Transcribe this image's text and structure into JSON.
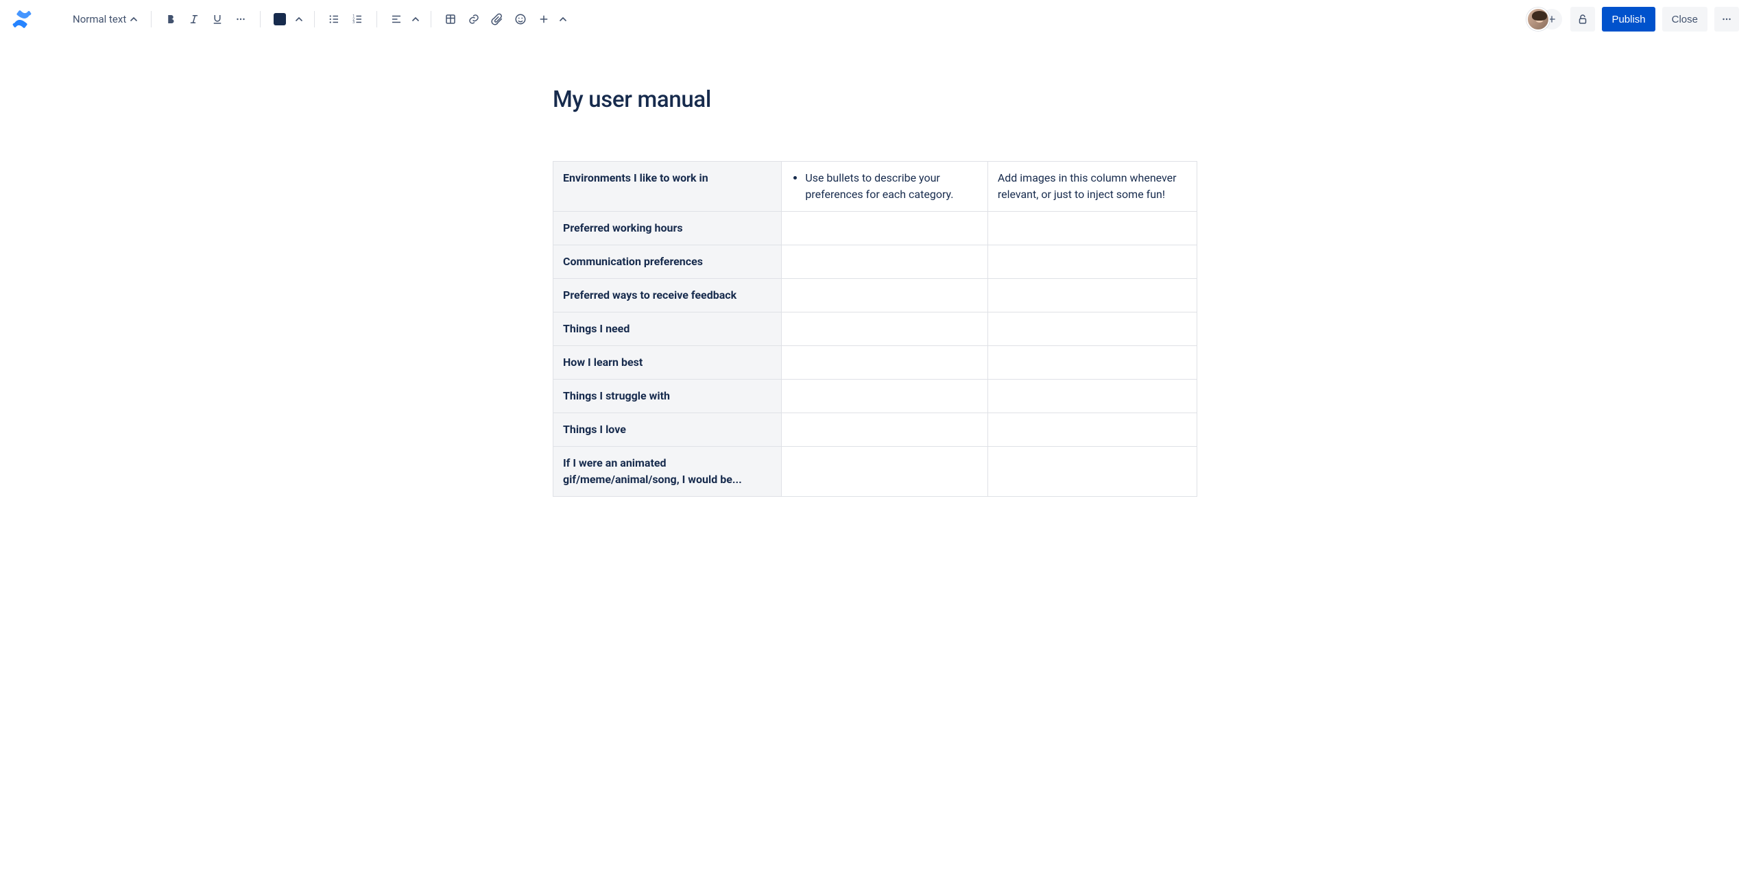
{
  "toolbar": {
    "text_style": "Normal text",
    "publish_label": "Publish",
    "close_label": "Close"
  },
  "page": {
    "title": "My user manual"
  },
  "table": {
    "rows": [
      {
        "label": "Environments I like to work in",
        "bullet": "Use bullets to describe your preferences for each category.",
        "note": "Add images in this column whenever relevant, or just to inject some fun!"
      },
      {
        "label": "Preferred working hours",
        "bullet": "",
        "note": ""
      },
      {
        "label": "Communication preferences",
        "bullet": "",
        "note": ""
      },
      {
        "label": "Preferred ways to receive feedback",
        "bullet": "",
        "note": ""
      },
      {
        "label": "Things I need",
        "bullet": "",
        "note": ""
      },
      {
        "label": "How I learn best",
        "bullet": "",
        "note": ""
      },
      {
        "label": "Things I struggle with",
        "bullet": "",
        "note": ""
      },
      {
        "label": "Things I love",
        "bullet": "",
        "note": ""
      },
      {
        "label": "If I were an animated gif/meme/animal/song, I would be...",
        "bullet": "",
        "note": ""
      }
    ]
  }
}
